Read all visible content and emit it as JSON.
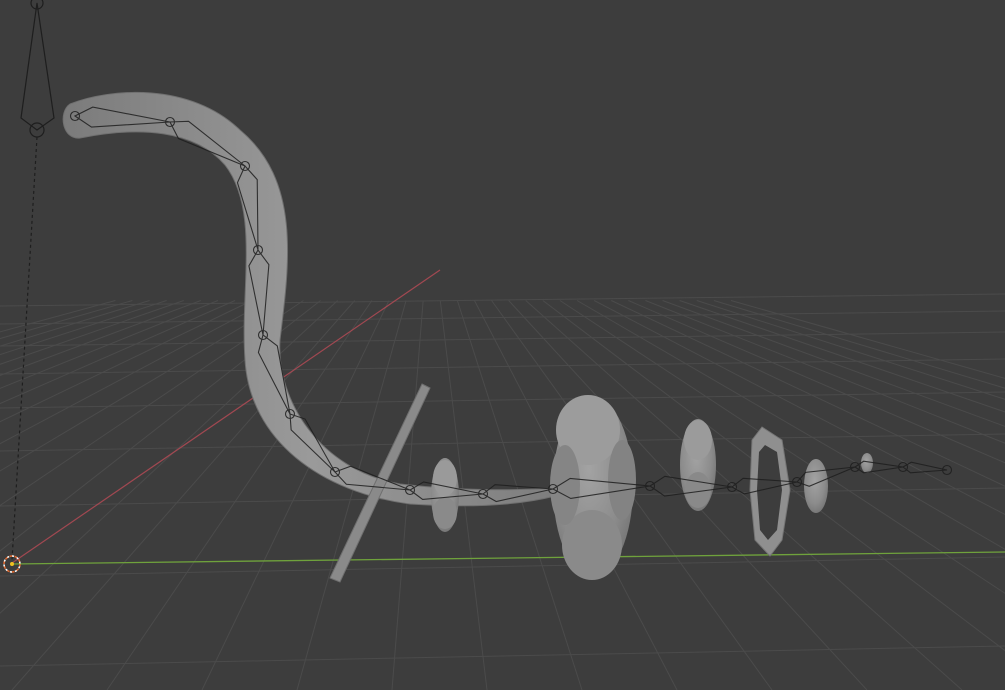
{
  "viewport": {
    "background_color": "#3d3d3d",
    "grid_color": "#4b4b4b",
    "x_axis_color": "#b34a55",
    "y_axis_color": "#6fa23c"
  },
  "objects": [
    {
      "name": "curved-tube-mesh",
      "type": "mesh",
      "color": "#8f8f8f"
    },
    {
      "name": "bone-chain-armature",
      "type": "armature",
      "color": "#1e1e1e"
    },
    {
      "name": "flat-blade-plane",
      "type": "mesh",
      "color": "#8a8a8a"
    },
    {
      "name": "small-cross-blob",
      "type": "mesh",
      "color": "#8c8c8c"
    },
    {
      "name": "large-cross-blob",
      "type": "mesh",
      "color": "#8d8d8d"
    },
    {
      "name": "medium-cross-blob",
      "type": "mesh",
      "color": "#8c8c8c"
    },
    {
      "name": "octagon-ring",
      "type": "mesh",
      "color": "#929292"
    },
    {
      "name": "tiny-cross-blob",
      "type": "mesh",
      "color": "#8c8c8c"
    },
    {
      "name": "micro-cross-blob",
      "type": "mesh",
      "color": "#8c8c8c"
    },
    {
      "name": "camera-rig",
      "type": "camera",
      "color": "#1e1e1e"
    },
    {
      "name": "3d-cursor",
      "type": "cursor",
      "color": "#e66a2e"
    }
  ]
}
